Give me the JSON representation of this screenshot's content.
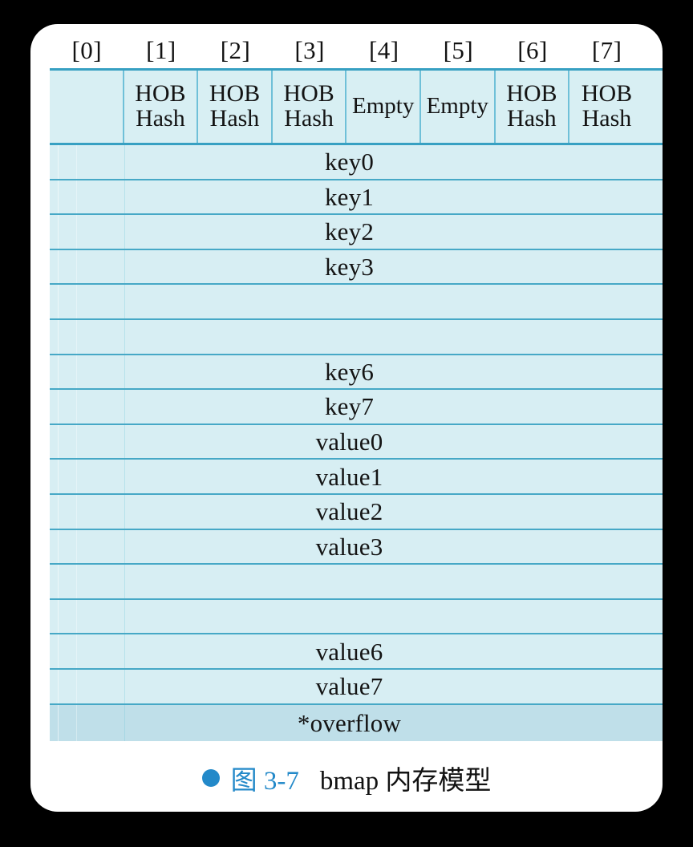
{
  "figure": {
    "column_indices": [
      "[0]",
      "[1]",
      "[2]",
      "[3]",
      "[4]",
      "[5]",
      "[6]",
      "[7]"
    ],
    "tophash_cells": [
      {
        "line1": "",
        "line2": "",
        "single": ""
      },
      {
        "line1": "HOB",
        "line2": "Hash",
        "single": ""
      },
      {
        "line1": "HOB",
        "line2": "Hash",
        "single": ""
      },
      {
        "line1": "HOB",
        "line2": "Hash",
        "single": ""
      },
      {
        "line1": "",
        "line2": "",
        "single": "Empty"
      },
      {
        "line1": "",
        "line2": "",
        "single": "Empty"
      },
      {
        "line1": "HOB",
        "line2": "Hash",
        "single": ""
      },
      {
        "line1": "HOB",
        "line2": "Hash",
        "single": ""
      }
    ],
    "rows": [
      {
        "label": "key0"
      },
      {
        "label": "key1"
      },
      {
        "label": "key2"
      },
      {
        "label": "key3"
      },
      {
        "label": ""
      },
      {
        "label": ""
      },
      {
        "label": "key6"
      },
      {
        "label": "key7"
      },
      {
        "label": "value0"
      },
      {
        "label": "value1"
      },
      {
        "label": "value2"
      },
      {
        "label": "value3"
      },
      {
        "label": ""
      },
      {
        "label": ""
      },
      {
        "label": "value6"
      },
      {
        "label": "value7"
      },
      {
        "label": "*overflow"
      }
    ],
    "colors": {
      "cell_fill": "#d7eef3",
      "border": "#46a8c6",
      "header_border": "#37a0c2",
      "overflow_fill": "#bfdfe9",
      "accent_blue": "#2389c9",
      "card_background": "#ffffff",
      "page_background": "#000000"
    }
  },
  "caption": {
    "bullet": "bullet-dot",
    "figure_number": "图 3-7",
    "title": "bmap 内存模型"
  }
}
